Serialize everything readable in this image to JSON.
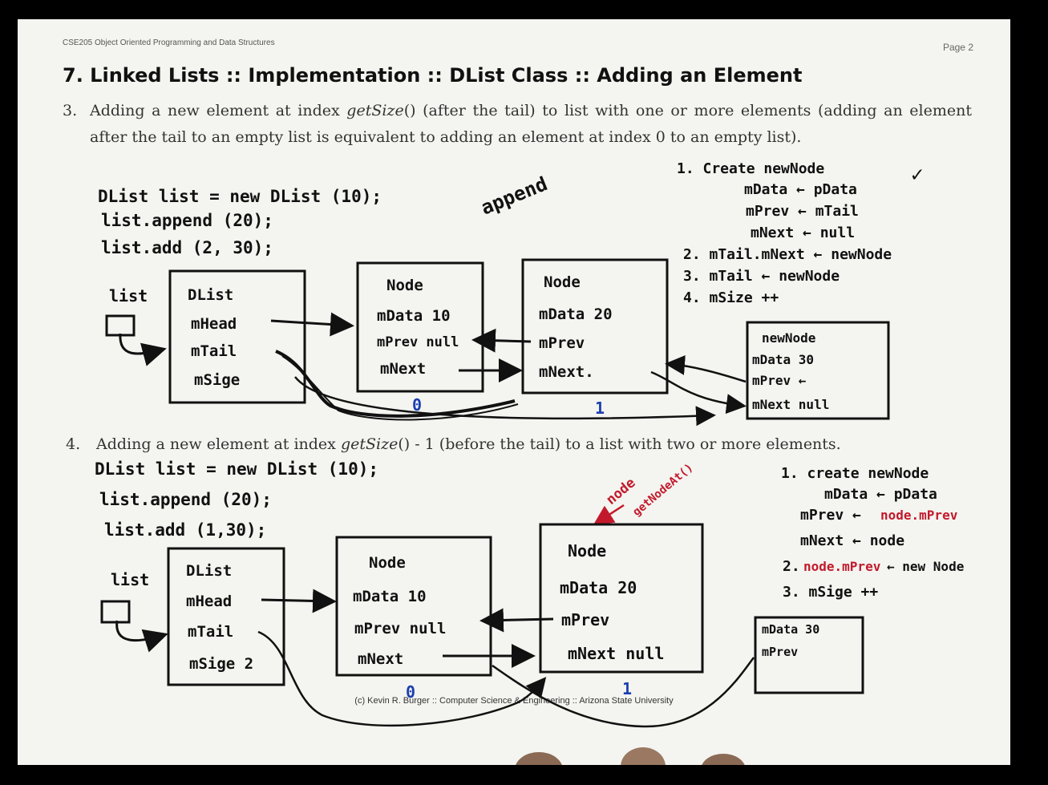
{
  "header": {
    "course": "CSE205 Object Oriented Programming and Data Structures",
    "page": "Page 2"
  },
  "title": "7. Linked Lists :: Implementation :: DList Class :: Adding an Element",
  "item3": {
    "number": "3.",
    "text_a": "Adding a new element at index ",
    "method": "getSize",
    "text_b": "() (after the tail) to list with one or more elements (adding an element after the tail to an empty list is equivalent to adding an element at index 0 to an empty list)."
  },
  "item4": {
    "number": "4.",
    "text_a": "Adding a new element at index ",
    "method": "getSize",
    "text_b": "() - 1 (before the tail) to a list with two or more elements."
  },
  "footer": "(c) Kevin R. Burger :: Computer Science & Engineering :: Arizona State University",
  "handwriting": {
    "code1": [
      "DList list = new DList (10);",
      "list.append (20);",
      "list.add (2, 30);"
    ],
    "append_note": "append",
    "steps1": [
      "1. Create newNode",
      "mData ← pData",
      "mPrev ← mTail",
      "mNext ← null",
      "2. mTail.mNext ← newNode",
      "3. mTail ← newNode",
      "4. mSize ++"
    ],
    "check": "✓",
    "list_label": "list",
    "dlist1": [
      "DList",
      "mHead",
      "mTail",
      "mSige"
    ],
    "node_a": [
      "Node",
      "mData 10",
      "mPrev null",
      "mNext"
    ],
    "node_b": [
      "Node",
      "mData 20",
      "mPrev",
      "mNext."
    ],
    "newnode": [
      "newNode",
      "mData 30",
      "mPrev ←",
      "mNext null"
    ],
    "index_0": "0",
    "index_1": "1",
    "code2": [
      "DList list = new DList (10);",
      "list.append (20);",
      "list.add (1,30);"
    ],
    "steps2": [
      "1. create newNode",
      "mData ← pData",
      "mPrev ←",
      "node.mPrev",
      "mNext ← node",
      "2.",
      "node.mPrev",
      "← new Node",
      "3. mSige ++"
    ],
    "red_note1": "node",
    "red_note2": "getNodeAt()",
    "dlist2": [
      "DList",
      "mHead",
      "mTail",
      "mSige 2"
    ],
    "node_c": [
      "Node",
      "mData 10",
      "mPrev null",
      "mNext"
    ],
    "node_d": [
      "Node",
      "mData 20",
      "mPrev",
      "mNext null"
    ],
    "newnode2": [
      "mData 30",
      "mPrev"
    ]
  },
  "colors": {
    "ink": "#111111",
    "red": "#c21a2c",
    "blue": "#1a3fb0"
  }
}
